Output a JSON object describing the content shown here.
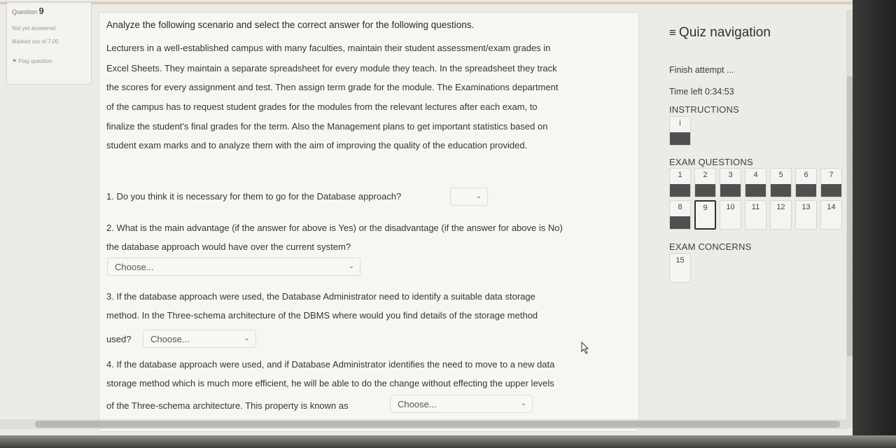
{
  "question_info": {
    "label": "Question",
    "number": "9",
    "status": "Not yet answered",
    "marked": "Marked out of 7.00",
    "flag": "Flag question"
  },
  "content": {
    "title": "Analyze the following scenario and select the correct answer for the following questions.",
    "scenario": [
      "Lecturers in a well-established campus with many faculties, maintain their student assessment/exam grades in",
      "Excel Sheets. They maintain a separate spreadsheet for every module they teach. In the spreadsheet they track",
      "the scores for every assignment and test. Then assign term grade for the module. The Examinations department",
      "of the campus has to request student grades for the modules from the relevant lectures after each exam, to",
      "finalize the student's final grades for the term. Also the Management plans to get important statistics based on",
      "student exam marks and to analyze them with the aim of improving the quality of the education provided."
    ],
    "q1": "1. Do you think it is necessary for them to go for the Database approach?",
    "q2_line1": "2. What is the main advantage (if the answer for above is Yes) or the disadvantage (if the answer for above is No)",
    "q2_line2": "the database approach would have over the current system?",
    "q3_line1": "3. If the database approach were used, the Database Administrator need to identify a suitable data storage",
    "q3_line2": "method. In the Three-schema architecture of the DBMS where would you find details of the storage method",
    "q3_line3": "used?",
    "q4_line1": "4. If the database approach were used, and if Database Administrator identifies the need to move to a new data",
    "q4_line2": "storage method which is much more efficient, he will be able to do the change without effecting the upper levels",
    "q4_line3": "of the Three-schema architecture. This property is known as",
    "q1_select": "",
    "choose": "Choose...",
    "chevron": "⌄"
  },
  "nav": {
    "menu_icon": "≡",
    "title": "Quiz navigation",
    "finish": "Finish attempt ...",
    "time_label": "Time left",
    "time_value": "0:34:53",
    "instructions_label": "INSTRUCTIONS",
    "instructions_item": "i",
    "exam_questions_label": "EXAM QUESTIONS",
    "row1": [
      "1",
      "2",
      "3",
      "4",
      "5",
      "6",
      "7"
    ],
    "row2": [
      "8",
      "9",
      "10",
      "11",
      "12",
      "13",
      "14"
    ],
    "exam_concerns_label": "EXAM CONCERNS",
    "concern_item": "15"
  }
}
